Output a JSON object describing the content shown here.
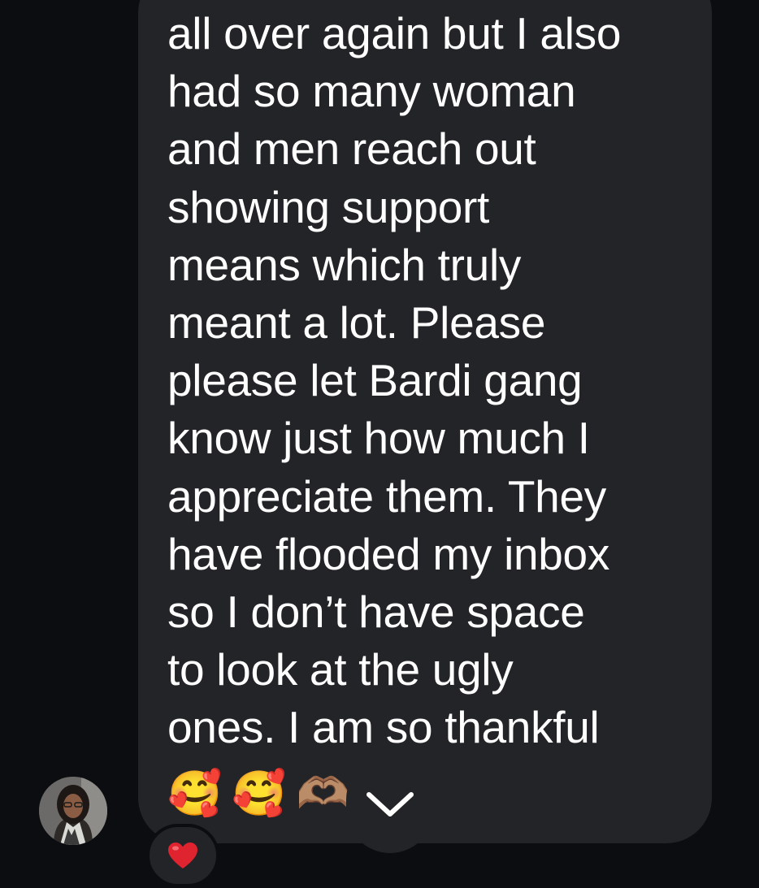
{
  "conversation": {
    "message": {
      "lines": [
        "all over again but I also",
        "had so many woman",
        "and men reach out",
        "showing support",
        "means which truly",
        "meant a lot. Please",
        "please let Bardi gang",
        "know just how much I",
        "appreciate them. They",
        "have flooded my inbox",
        "so I don’t have space",
        "to look at the ugly",
        "ones. I am so thankful"
      ],
      "emojis": [
        "🥰",
        "🥰",
        "🫶🏽"
      ]
    },
    "reaction": {
      "icon": "heart-icon"
    },
    "scroll_button": {
      "icon": "chevron-down-icon"
    },
    "sender": {
      "avatar_icon": "avatar"
    }
  },
  "colors": {
    "background": "#0b0d11",
    "bubble": "#222428",
    "text": "#ffffff",
    "heart": "#e0242f"
  }
}
